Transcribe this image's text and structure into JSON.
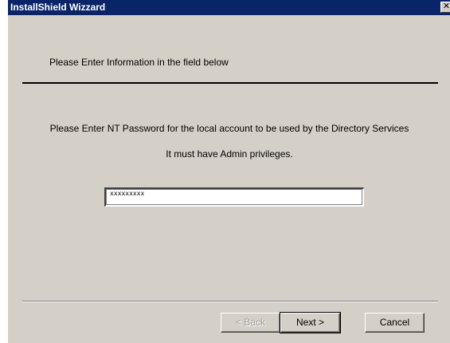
{
  "window": {
    "title": "InstallShield Wizzard",
    "close_glyph": "✕"
  },
  "header": {
    "text": "Please Enter Information in the field below"
  },
  "body": {
    "line1": "Please Enter NT Password for the local account to be used by the Directory Services",
    "line2": "It must have Admin privileges."
  },
  "password_field": {
    "value": "xxxxxxxxx"
  },
  "buttons": {
    "back": "< Back",
    "next": "Next >",
    "cancel": "Cancel"
  },
  "colors": {
    "titlebar": "#0a246a",
    "dialog_face": "#d4d0c8"
  },
  "icons": {
    "close": "close-icon"
  }
}
